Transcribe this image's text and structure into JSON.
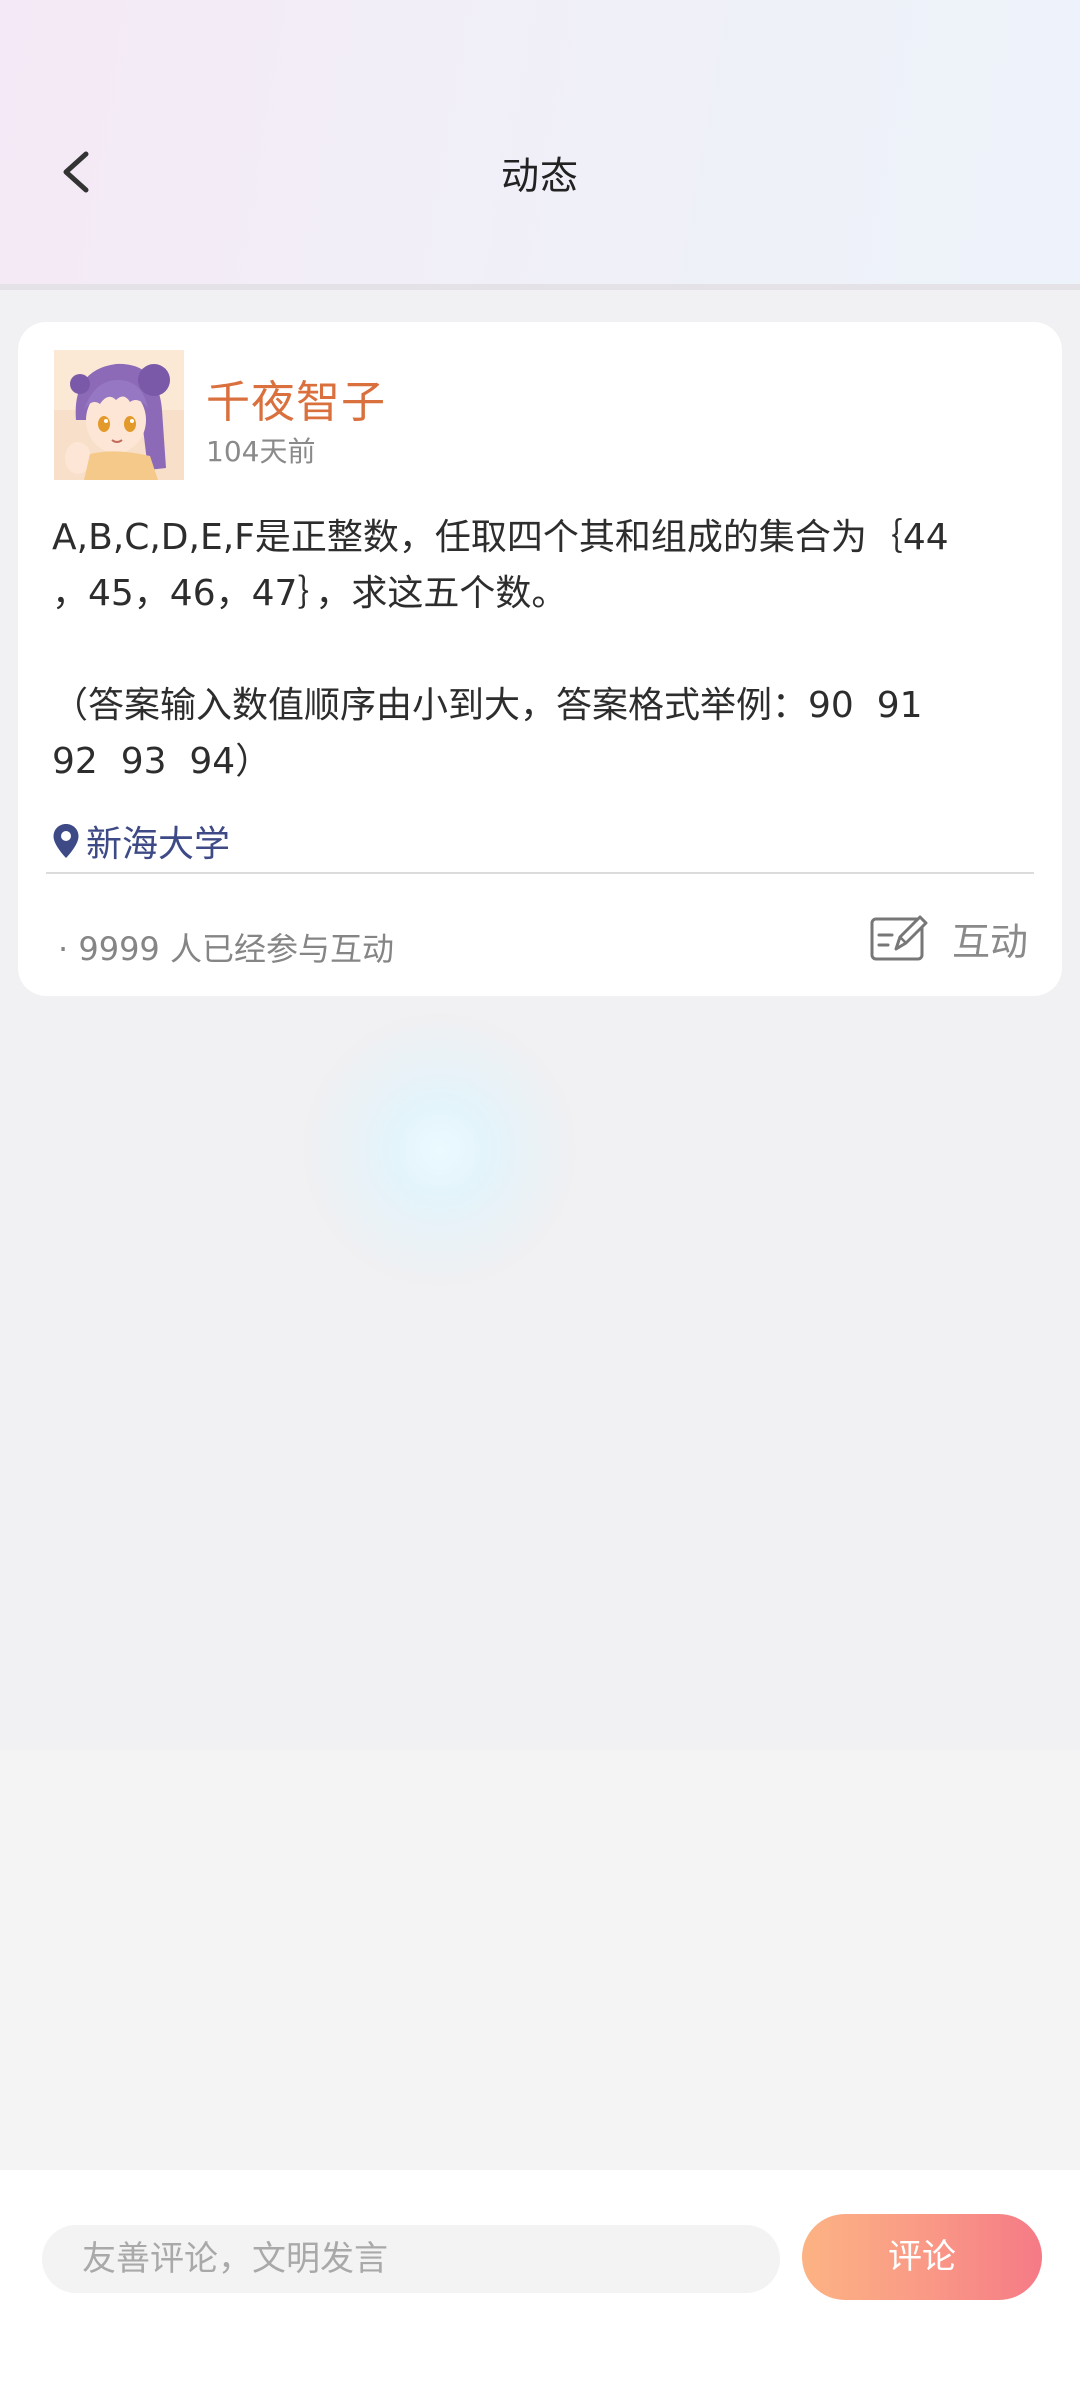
{
  "header": {
    "title": "动态"
  },
  "post": {
    "author": "千夜智子",
    "time": "104天前",
    "content_line1": "A,B,C,D,E,F是正整数，任取四个其和组成的集合为｛44",
    "content_line2": "，45，46，47｝，求这五个数。",
    "content_line3": "",
    "content_line4": "（答案输入数值顺序由小到大，答案格式举例：90  91",
    "content_line5": "92  93  94）",
    "location": "新海大学",
    "participants_text": "· 9999  人已经参与互动",
    "interact_label": "互动"
  },
  "comment_bar": {
    "placeholder": "友善评论，文明发言",
    "submit_label": "评论"
  },
  "icons": {
    "back": "back-arrow-icon",
    "location": "location-pin-icon",
    "interact": "edit-note-icon"
  },
  "colors": {
    "author_name": "#d9703d",
    "location": "#3e4a86",
    "comment_button_start": "#fcb383",
    "comment_button_end": "#f57a86"
  }
}
